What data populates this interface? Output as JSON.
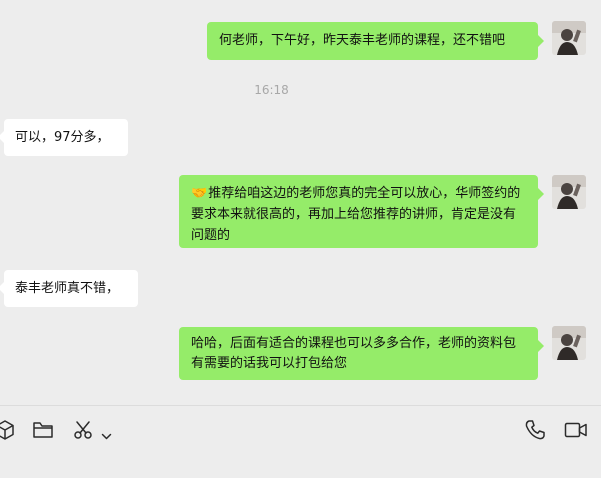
{
  "messages": [
    {
      "direction": "out",
      "text": "何老师，下午好，昨天泰丰老师的课程，还不错吧",
      "avatar": "user-avatar"
    },
    {
      "direction": "in",
      "text": "可以，97分多，"
    },
    {
      "direction": "out",
      "emoji": "🤝",
      "text": "推荐给咱这边的老师您真的完全可以放心，华师签约的要求本来就很高的，再加上给您推荐的讲师，肯定是没有问题的",
      "avatar": "user-avatar"
    },
    {
      "direction": "in",
      "text": "泰丰老师真不错，"
    },
    {
      "direction": "out",
      "text": "哈哈，后面有适合的课程也可以多多合作，老师的资料包有需要的话我可以打包给您",
      "avatar": "user-avatar"
    }
  ],
  "timestamp": "16:18",
  "toolbar": {
    "left": [
      "cube-icon",
      "folder-icon",
      "scissors-icon",
      "chevron-down-icon"
    ],
    "right": [
      "phone-icon",
      "video-call-icon"
    ]
  },
  "colors": {
    "background": "#ededed",
    "bubble_out": "#95ec69",
    "bubble_in": "#ffffff",
    "timestamp": "#a8a8a8"
  }
}
